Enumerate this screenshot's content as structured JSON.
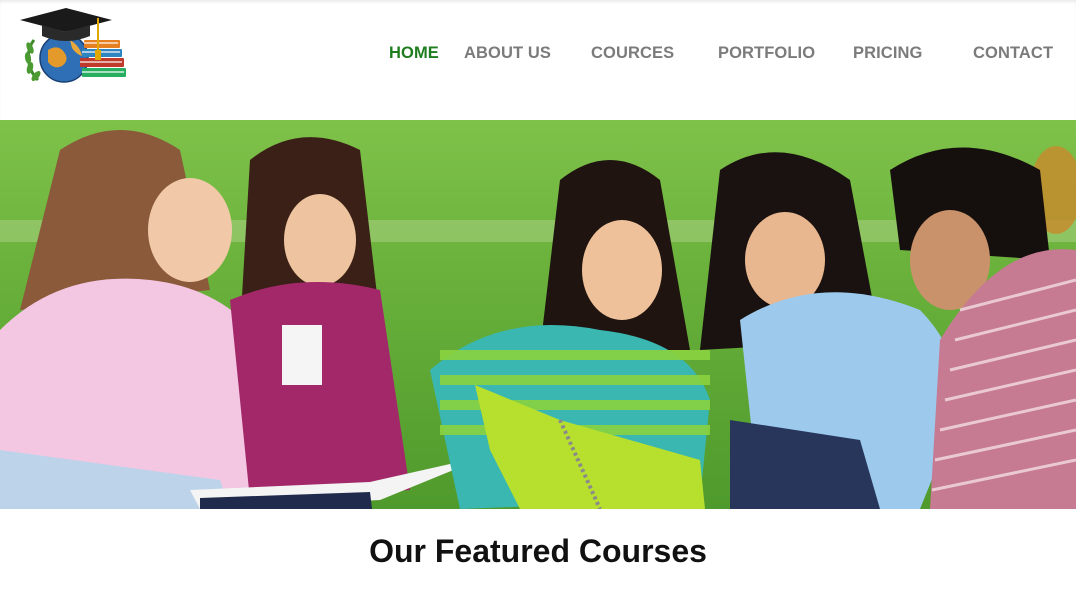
{
  "nav": {
    "items": [
      {
        "label": "HOME",
        "active": true
      },
      {
        "label": "ABOUT US",
        "active": false
      },
      {
        "label": "COURCES",
        "active": false
      },
      {
        "label": "PORTFOLIO",
        "active": false
      },
      {
        "label": "PRICING",
        "active": false
      },
      {
        "label": "CONTACT",
        "active": false
      }
    ]
  },
  "hero": {
    "image": "students-studying-on-grass-photo"
  },
  "featured": {
    "title": "Our Featured Courses"
  },
  "colors": {
    "nav_active": "#1f7d1f",
    "nav_default": "#7b7b7b",
    "heading": "#111111"
  }
}
